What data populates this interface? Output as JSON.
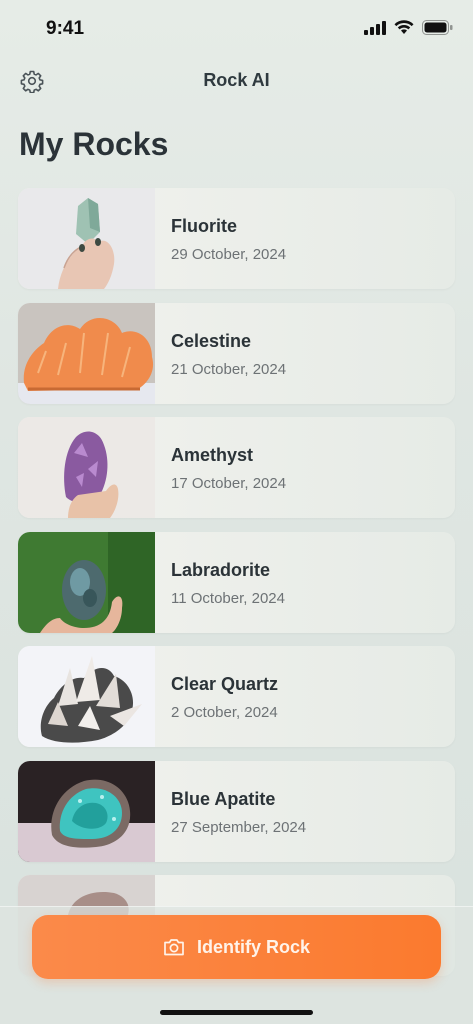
{
  "status_bar": {
    "time": "9:41"
  },
  "nav": {
    "title": "Rock AI",
    "settings_icon": "gear-icon"
  },
  "page": {
    "title": "My Rocks"
  },
  "rocks": [
    {
      "name": "Fluorite",
      "date": "29 October, 2024"
    },
    {
      "name": "Celestine",
      "date": "21 October, 2024"
    },
    {
      "name": "Amethyst",
      "date": "17 October, 2024"
    },
    {
      "name": "Labradorite",
      "date": "11 October, 2024"
    },
    {
      "name": "Clear Quartz",
      "date": "2 October, 2024"
    },
    {
      "name": "Blue Apatite",
      "date": "27 September, 2024"
    },
    {
      "name": "",
      "date": ""
    }
  ],
  "action": {
    "label": "Identify Rock",
    "icon": "camera-icon",
    "color": "#fb7a2e"
  }
}
